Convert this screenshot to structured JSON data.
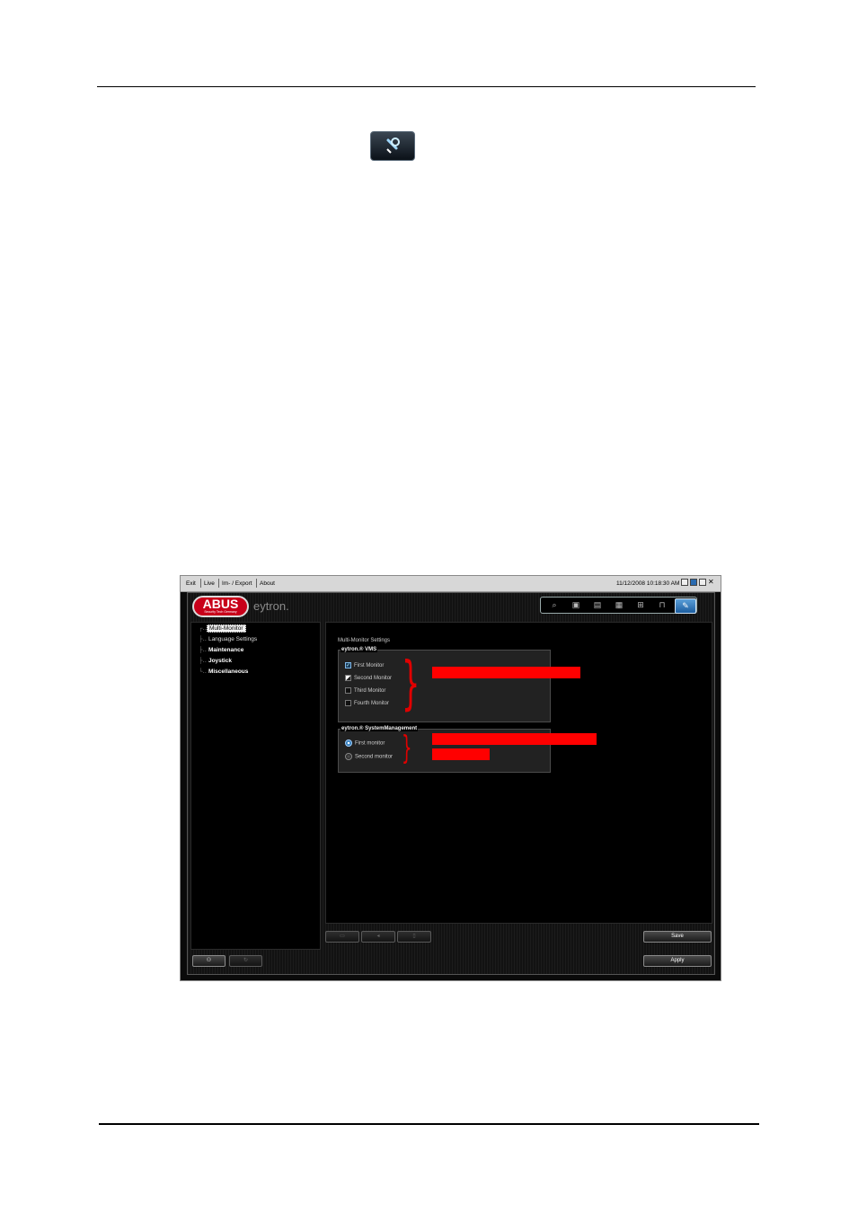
{
  "menu": {
    "items": [
      "Exit",
      "Live",
      "Im- / Export",
      "About"
    ],
    "datetime": "11/12/2008 10:18:30 AM"
  },
  "brand": {
    "logo": "ABUS",
    "tagline": "Security Tech Germany",
    "product": "eytron."
  },
  "toolbar": {
    "icons": [
      "search-icon",
      "camera-export-icon",
      "events-icon",
      "layout-icon",
      "network-icon",
      "lock-icon",
      "settings-tool-icon"
    ],
    "active": "settings-tool-icon"
  },
  "tree": {
    "items": [
      {
        "label": "Multi-Monitor",
        "selected": true
      },
      {
        "label": "Language Settings"
      },
      {
        "label": "Maintenance"
      },
      {
        "label": "Joystick"
      },
      {
        "label": "Miscellaneous"
      }
    ]
  },
  "settings": {
    "title": "Multi-Monitor Settings",
    "vms": {
      "title": "eytron.® VMS",
      "options": [
        {
          "label": "First Monitor",
          "state": "checked"
        },
        {
          "label": "Second Monitor",
          "state": "partial"
        },
        {
          "label": "Third Monitor",
          "state": "unchecked"
        },
        {
          "label": "Fourth Monitor",
          "state": "unchecked"
        }
      ]
    },
    "sysmgmt": {
      "title": "eytron.® SystemManagement",
      "options": [
        {
          "label": "First monitor",
          "selected": true
        },
        {
          "label": "Second monitor",
          "selected": false
        }
      ]
    }
  },
  "buttons": {
    "save": "Save",
    "apply": "Apply"
  },
  "colors": {
    "annotation": "#ff0000",
    "accent": "#4f9fe0"
  }
}
